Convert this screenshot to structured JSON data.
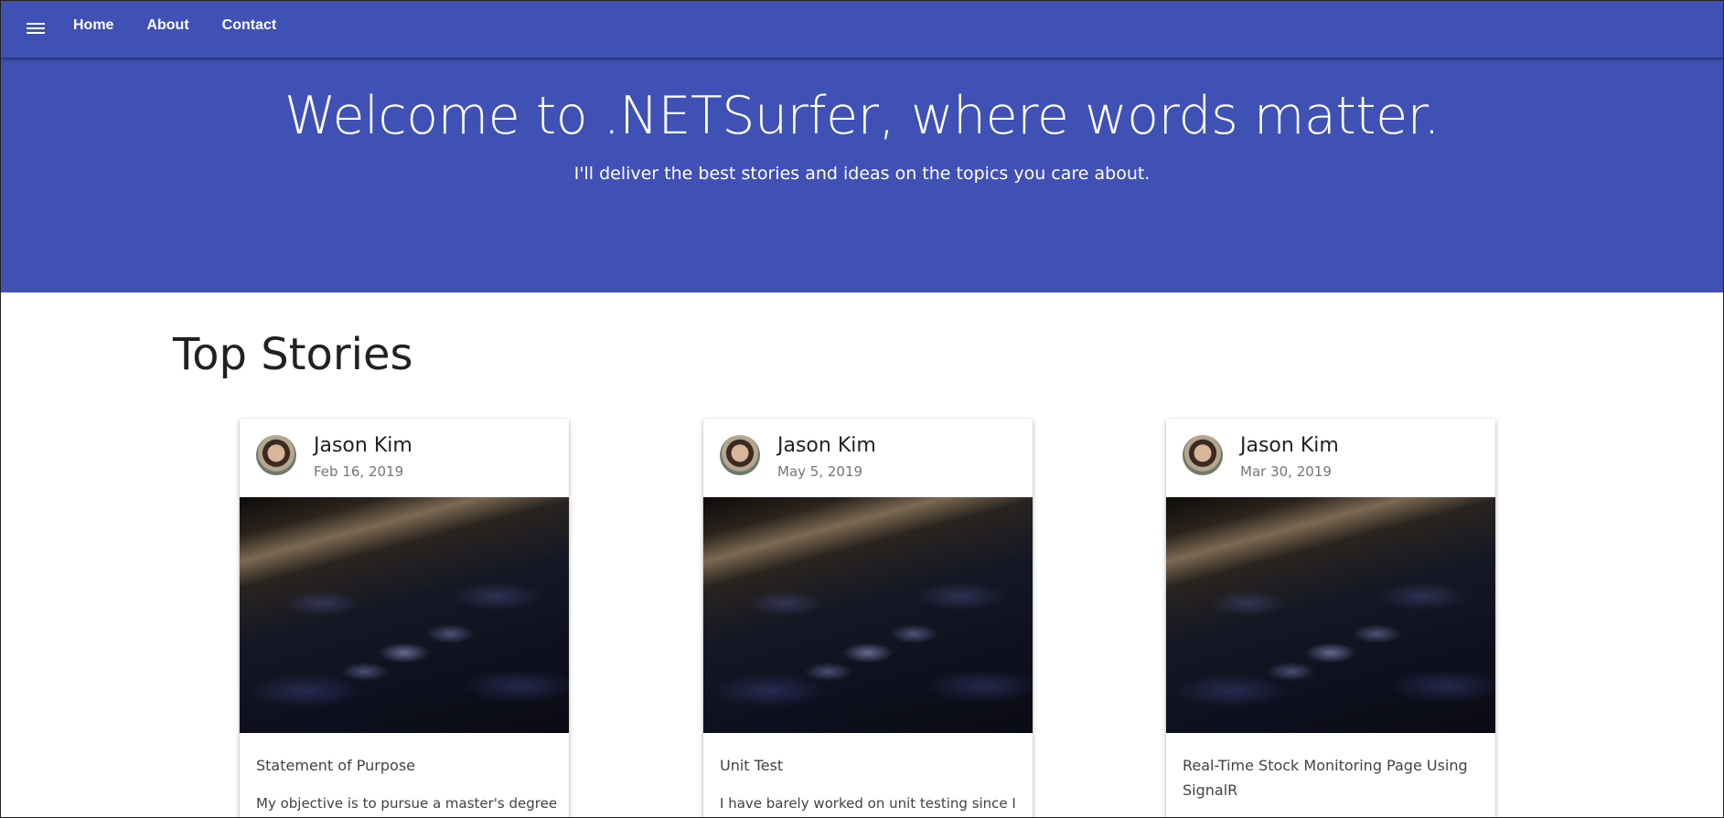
{
  "nav": {
    "items": [
      "Home",
      "About",
      "Contact"
    ]
  },
  "hero": {
    "title": "Welcome to .NETSurfer, where words matter.",
    "subtitle": "I'll deliver the best stories and ideas on the topics you care about."
  },
  "section": {
    "title": "Top Stories"
  },
  "cards": [
    {
      "author": "Jason Kim",
      "date": "Feb 16, 2019",
      "title": "Statement of Purpose",
      "excerpt": "My objective is to pursue a master's degree in"
    },
    {
      "author": "Jason Kim",
      "date": "May 5, 2019",
      "title": "Unit Test",
      "excerpt": "I have barely worked on unit testing since I"
    },
    {
      "author": "Jason Kim",
      "date": "Mar 30, 2019",
      "title": "Real-Time Stock Monitoring Page Using SignalR",
      "excerpt": ""
    }
  ],
  "colors": {
    "primary": "#3f51b5",
    "text_dark": "#212121",
    "text_muted": "#757575"
  },
  "icons": {
    "menu": "hamburger-menu-icon"
  }
}
